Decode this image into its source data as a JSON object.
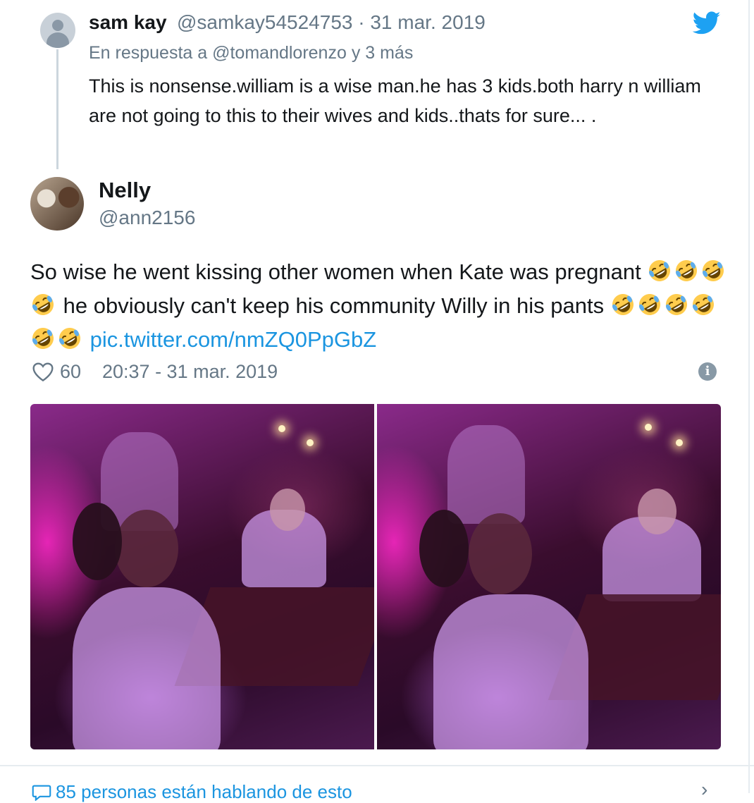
{
  "reply_tweet": {
    "name": "sam kay",
    "meta": "@samkay54524753 · 31 mar. 2019",
    "reply_to": "En respuesta a @tomandlorenzo y 3 más",
    "text": "This is nonsense.william is a wise man.he has 3 kids.both harry n william are not going to this to their wives and kids..thats for sure... ."
  },
  "main_tweet": {
    "name": "Nelly",
    "handle": "@ann2156",
    "text_part1": "So wise he went kissing other women when Kate was pregnant ",
    "text_part2": " he obviously can't keep his community Willy in his pants ",
    "link": "pic.twitter.com/nmZQ0PpGbZ",
    "emoji_group1_count": 4,
    "emoji_group2_count": 6,
    "emoji": "rolling-on-floor-laughing",
    "likes": "60",
    "timestamp": "20:37 - 31 mar. 2019"
  },
  "footer": {
    "text": "85 personas están hablando de esto",
    "chevron": "›"
  },
  "icons": {
    "brand": "twitter-bird-icon",
    "like": "heart-icon",
    "info": "info-icon",
    "conversation": "speech-bubble-icon"
  },
  "colors": {
    "link": "#1b95e0",
    "muted": "#657786",
    "text": "#14171a",
    "twitter_blue": "#1da1f2"
  }
}
